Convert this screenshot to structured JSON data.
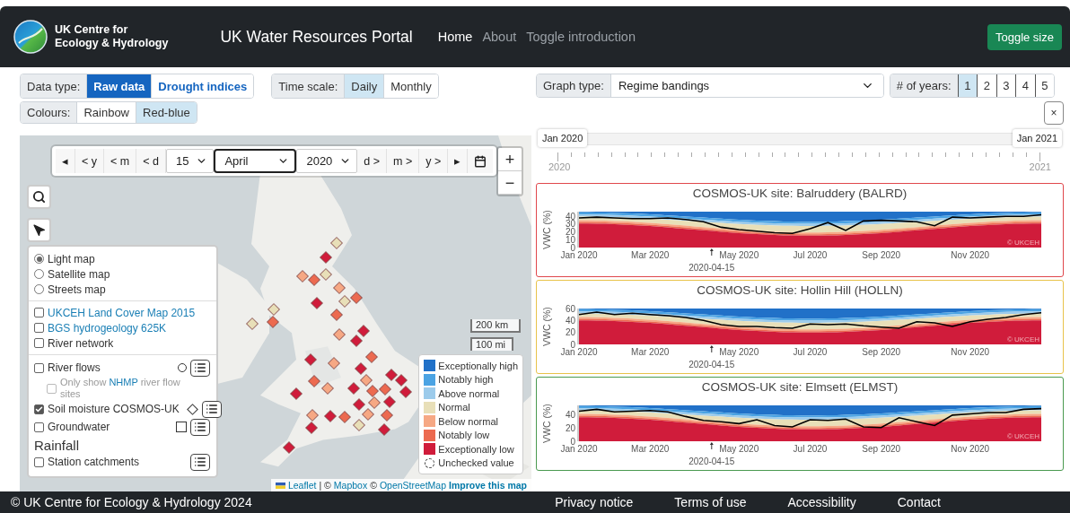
{
  "header": {
    "org_lines": [
      "UK Centre for",
      "Ecology & Hydrology"
    ],
    "title": "UK Water Resources Portal",
    "nav": [
      {
        "label": "Home",
        "selected": true
      },
      {
        "label": "About",
        "selected": false
      },
      {
        "label": "Toggle introduction",
        "selected": false
      }
    ],
    "toggle_button": "Toggle size"
  },
  "controls": [
    {
      "label": "Data type:",
      "kind": "dark",
      "options": [
        {
          "label": "Raw data",
          "selected": true
        },
        {
          "label": "Drought indices",
          "selected": false
        }
      ]
    },
    {
      "label": "Time scale:",
      "kind": "light",
      "options": [
        {
          "label": "Daily",
          "selected": true
        },
        {
          "label": "Monthly",
          "selected": false
        }
      ]
    },
    {
      "label": "Colours:",
      "kind": "light",
      "options": [
        {
          "label": "Rainbow",
          "selected": false
        },
        {
          "label": "Red-blue",
          "selected": true
        }
      ]
    }
  ],
  "map": {
    "date_bar": [
      {
        "kind": "button",
        "label": "◂"
      },
      {
        "kind": "button",
        "label": "< y"
      },
      {
        "kind": "button",
        "label": "< m"
      },
      {
        "kind": "button",
        "label": "< d"
      },
      {
        "kind": "select",
        "label": "15",
        "focused": false
      },
      {
        "kind": "select",
        "label": "April",
        "focused": true
      },
      {
        "kind": "select",
        "label": "2020",
        "focused": false
      },
      {
        "kind": "button",
        "label": "d >"
      },
      {
        "kind": "button",
        "label": "m >"
      },
      {
        "kind": "button",
        "label": "y >"
      },
      {
        "kind": "button",
        "label": "▸"
      },
      {
        "kind": "calendar"
      }
    ],
    "zoom": [
      "+",
      "−"
    ],
    "base_maps": [
      {
        "label": "Light map",
        "selected": true
      },
      {
        "label": "Satellite map",
        "selected": false
      },
      {
        "label": "Streets map",
        "selected": false
      }
    ],
    "overlays": [
      {
        "label": "UKCEH Land Cover Map 2015",
        "link": true,
        "checked": false
      },
      {
        "label": "BGS hydrogeology 625K",
        "link": true,
        "checked": false
      },
      {
        "label": "River network",
        "link": false,
        "checked": false
      }
    ],
    "data_layers": [
      {
        "kind": "circle",
        "label": "River flows",
        "checked": false,
        "list": true
      },
      {
        "kind": "sub-option",
        "parts": [
          "Only show ",
          "NHMP",
          " river flow sites"
        ],
        "checked": false,
        "disabled": true
      },
      {
        "kind": "diamond",
        "label": "Soil moisture COSMOS-UK",
        "checked": true,
        "list": true
      },
      {
        "kind": "square",
        "label": "Groundwater",
        "checked": false,
        "list": true
      },
      {
        "kind": "heading",
        "label": "Rainfall"
      },
      {
        "kind": "plain",
        "label": "Station catchments",
        "checked": false,
        "list": true
      }
    ],
    "scale": [
      "200 km",
      "100 mi"
    ],
    "legend": [
      {
        "kind": "band",
        "label": "Exceptionally high",
        "color": "#2171c8"
      },
      {
        "kind": "band",
        "label": "Notably high",
        "color": "#4ba3e3"
      },
      {
        "kind": "band",
        "label": "Above normal",
        "color": "#9ccbeb"
      },
      {
        "kind": "band",
        "label": "Normal",
        "color": "#e8dfb8"
      },
      {
        "kind": "band",
        "label": "Below normal",
        "color": "#f6a884"
      },
      {
        "kind": "band",
        "label": "Notably low",
        "color": "#ec6a50"
      },
      {
        "kind": "band",
        "label": "Exceptionally low",
        "color": "#d01c3b"
      },
      {
        "kind": "unchecked",
        "label": "Unchecked value"
      }
    ],
    "sites": [
      {
        "color": "#e8dfb8"
      },
      {
        "color": "#d01c3b"
      },
      {
        "color": "#f6a884"
      },
      {
        "color": "#ec6a50"
      },
      {
        "color": "#e8dfb8"
      },
      {
        "color": "#f6a884"
      },
      {
        "color": "#e8dfb8"
      },
      {
        "color": "#ec6a50"
      },
      {
        "color": "#d01c3b"
      },
      {
        "color": "#ec6a50"
      },
      {
        "color": "#e8dfb8"
      },
      {
        "color": "#ec6a50"
      },
      {
        "color": "#e8dfb8"
      },
      {
        "color": "#d01c3b"
      },
      {
        "color": "#f6a884"
      },
      {
        "color": "#d01c3b"
      },
      {
        "color": "#ec6a50"
      },
      {
        "color": "#f6a884"
      },
      {
        "color": "#d01c3b"
      },
      {
        "color": "#d01c3b"
      },
      {
        "color": "#f6a884"
      },
      {
        "color": "#d01c3b"
      },
      {
        "color": "#d01c3b"
      },
      {
        "color": "#d01c3b"
      },
      {
        "color": "#ec6a50"
      },
      {
        "color": "#d01c3b"
      },
      {
        "color": "#f6a884"
      },
      {
        "color": "#d01c3b"
      },
      {
        "color": "#ec6a50"
      },
      {
        "color": "#ec6a50"
      },
      {
        "color": "#f6a884"
      },
      {
        "color": "#d01c3b"
      },
      {
        "color": "#d01c3b"
      },
      {
        "color": "#f6a884"
      },
      {
        "color": "#d01c3b"
      },
      {
        "color": "#ec6a50"
      },
      {
        "color": "#e8dfb8"
      },
      {
        "color": "#ec6a50"
      },
      {
        "color": "#f6a884"
      },
      {
        "color": "#d01c3b"
      },
      {
        "color": "#d01c3b"
      },
      {
        "color": "#d01c3b"
      }
    ],
    "attribution": [
      {
        "text": "Leaflet",
        "link": true,
        "bold": false
      },
      {
        "text": "| ©",
        "link": false,
        "bold": false
      },
      {
        "text": "Mapbox",
        "link": true,
        "bold": false
      },
      {
        "text": "©",
        "link": false,
        "bold": false
      },
      {
        "text": "OpenStreetMap",
        "link": true,
        "bold": false
      },
      {
        "text": "Improve this map",
        "link": true,
        "bold": true
      }
    ]
  },
  "graph_type": {
    "label": "Graph type:",
    "value": "Regime bandings"
  },
  "years": {
    "label": "# of years:",
    "options": [
      {
        "label": "1",
        "selected": true
      },
      {
        "label": "2",
        "selected": false
      },
      {
        "label": "3",
        "selected": false
      },
      {
        "label": "4",
        "selected": false
      },
      {
        "label": "5",
        "selected": false
      }
    ]
  },
  "close_button": "×",
  "timeline": {
    "start": "Jan 2020",
    "end": "Jan 2021",
    "level": 1,
    "tick_labels": [
      "2020",
      "2021"
    ]
  },
  "charts": [
    {
      "color": "#e0474c",
      "credit": "© UKCEH",
      "chart_data": {
        "type": "line",
        "title": "COSMOS-UK site: Balruddery (BALRD)",
        "ylabel": "VWC (%)",
        "ylim": [
          0,
          46
        ],
        "yticks": [
          0,
          10,
          20,
          30,
          40
        ],
        "annotations": [
          "2020-04-15"
        ],
        "categories": [
          "Jan 2020",
          null,
          null,
          null,
          "Mar 2020",
          null,
          null,
          null,
          null,
          "May 2020",
          null,
          null,
          null,
          "Jul 2020",
          null,
          null,
          null,
          "Sep 2020",
          null,
          null,
          null,
          null,
          "Nov 2020",
          null,
          null,
          null,
          null
        ],
        "series": [
          {
            "color": "#000000",
            "values": [
              38,
              39,
              38,
              37,
              37,
              38,
              36,
              33,
              26,
              23,
              21,
              19,
              18,
              24,
              32,
              22,
              34,
              35,
              34,
              33,
              28,
              39,
              38,
              39,
              40,
              40,
              42
            ]
          }
        ]
      }
    },
    {
      "color": "#e8c34a",
      "credit": "© UKCEH",
      "chart_data": {
        "type": "line",
        "title": "COSMOS-UK site: Hollin Hill (HOLLN)",
        "ylabel": "VWC (%)",
        "ylim": [
          0,
          60
        ],
        "yticks": [
          0,
          20,
          40,
          60
        ],
        "annotations": [
          "2020-04-15"
        ],
        "categories": [
          "Jan 2020",
          null,
          null,
          null,
          "Mar 2020",
          null,
          null,
          null,
          null,
          "May 2020",
          null,
          null,
          null,
          "Jul 2020",
          null,
          null,
          null,
          "Sep 2020",
          null,
          null,
          null,
          null,
          "Nov 2020",
          null,
          null,
          null,
          null
        ],
        "series": [
          {
            "color": "#000000",
            "values": [
              50,
              54,
              50,
              52,
              50,
              48,
              45,
              40,
              33,
              30,
              30,
              28,
              27,
              34,
              33,
              34,
              31,
              29,
              27,
              38,
              36,
              30,
              38,
              42,
              45,
              50,
              53
            ]
          }
        ]
      }
    },
    {
      "color": "#4a9a4f",
      "credit": "© UKCEH",
      "chart_data": {
        "type": "line",
        "title": "COSMOS-UK site: Elmsett (ELMST)",
        "ylabel": "VWC (%)",
        "ylim": [
          0,
          55
        ],
        "yticks": [
          0,
          20,
          40
        ],
        "annotations": [
          "2020-04-15"
        ],
        "categories": [
          "Jan 2020",
          null,
          null,
          null,
          "Mar 2020",
          null,
          null,
          null,
          null,
          "May 2020",
          null,
          null,
          null,
          "Jul 2020",
          null,
          null,
          null,
          "Sep 2020",
          null,
          null,
          null,
          null,
          "Nov 2020",
          null,
          null,
          null,
          null
        ],
        "series": [
          {
            "color": "#000000",
            "values": [
              46,
              49,
              45,
              46,
              47,
              45,
              38,
              32,
              30,
              27,
              33,
              24,
              22,
              33,
              32,
              34,
              22,
              21,
              36,
              30,
              24,
              40,
              42,
              44,
              44,
              49,
              50
            ]
          }
        ]
      }
    }
  ],
  "footer": {
    "copyright": "© UK Centre for Ecology & Hydrology 2024",
    "links": [
      "Privacy notice",
      "Terms of use",
      "Accessibility",
      "Contact"
    ]
  }
}
